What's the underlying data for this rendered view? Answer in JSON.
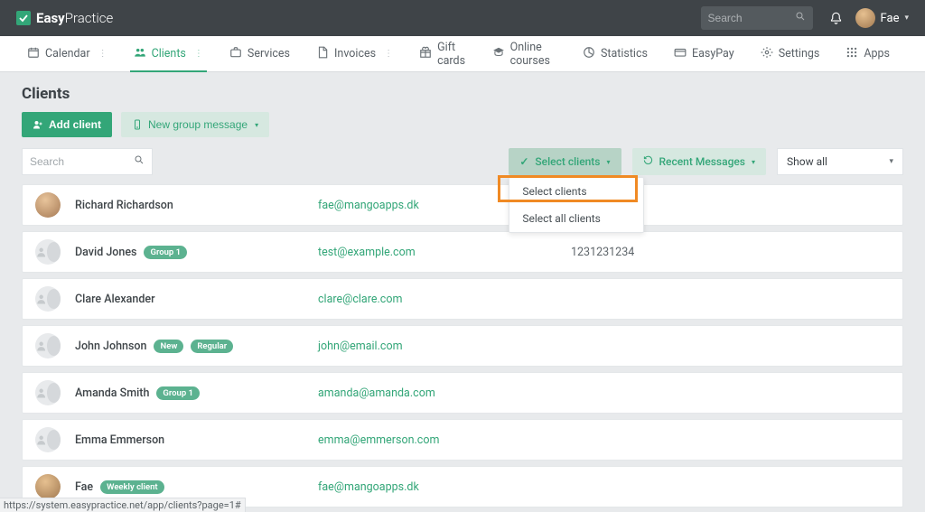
{
  "header": {
    "brand_bold": "Easy",
    "brand_light": "Practice",
    "search_placeholder": "Search",
    "user_name": "Fae"
  },
  "nav": {
    "calendar": "Calendar",
    "clients": "Clients",
    "services": "Services",
    "invoices": "Invoices",
    "giftcards": "Gift cards",
    "onlinecourses": "Online courses",
    "statistics": "Statistics",
    "easypay": "EasyPay",
    "settings": "Settings",
    "apps": "Apps"
  },
  "page": {
    "title": "Clients",
    "add_client": "Add client",
    "new_group_message": "New group message",
    "search_placeholder": "Search",
    "select_clients": "Select clients",
    "recent_messages": "Recent Messages",
    "show_all": "Show all"
  },
  "dropdown": {
    "select_clients": "Select clients",
    "select_all_clients": "Select all clients"
  },
  "clients": [
    {
      "name": "Richard Richardson",
      "email": "fae@mangoapps.dk",
      "phone": "",
      "badges": [],
      "avatar": "photo1"
    },
    {
      "name": "David Jones",
      "email": "test@example.com",
      "phone": "1231231234",
      "badges": [
        "Group 1"
      ],
      "avatar": "generic"
    },
    {
      "name": "Clare Alexander",
      "email": "clare@clare.com",
      "phone": "",
      "badges": [],
      "avatar": "generic"
    },
    {
      "name": "John Johnson",
      "email": "john@email.com",
      "phone": "",
      "badges": [
        "New",
        "Regular"
      ],
      "avatar": "generic"
    },
    {
      "name": "Amanda Smith",
      "email": "amanda@amanda.com",
      "phone": "",
      "badges": [
        "Group 1"
      ],
      "avatar": "generic"
    },
    {
      "name": "Emma Emmerson",
      "email": "emma@emmerson.com",
      "phone": "",
      "badges": [],
      "avatar": "generic"
    },
    {
      "name": "Fae",
      "email": "fae@mangoapps.dk",
      "phone": "",
      "badges": [
        "Weekly client"
      ],
      "avatar": "photo2"
    }
  ],
  "status_url": "https://system.easypractice.net/app/clients?page=1#"
}
